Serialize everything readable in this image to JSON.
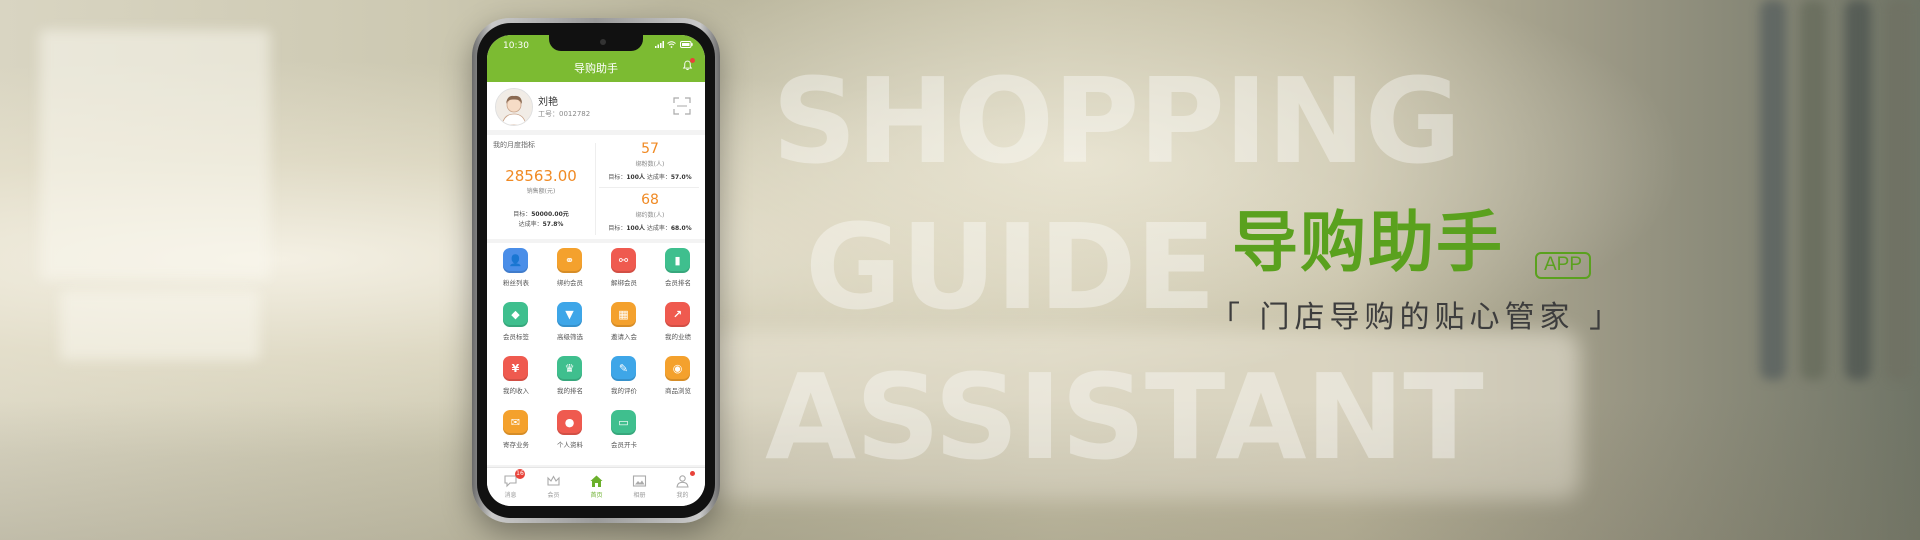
{
  "headline": {
    "en_lines": [
      "SHOPPING",
      "GUIDE",
      "ASSISTANT"
    ],
    "cn_title": "导购助手",
    "badge": "APP",
    "slogan": "「 门店导购的贴心管家 」"
  },
  "colors": {
    "brand_green": "#7cbb32",
    "title_green": "#5aa11e",
    "value_orange": "#f08a24"
  },
  "phone": {
    "status_time": "10:30",
    "nav_title": "导购助手",
    "profile": {
      "name": "刘艳",
      "employee_id": "工号：0012782"
    },
    "stats": {
      "title": "我的月度指标",
      "sales": {
        "value": "28563.00",
        "label": "销售额(元)",
        "target_label": "目标：",
        "target_value": "50000.00元",
        "rate_label": "达成率：",
        "rate_value": "57.8%"
      },
      "metrics": [
        {
          "value": "57",
          "label": "绑粉数(人)",
          "target_label": "目标：",
          "target_value": "100人",
          "rate_label": "达成率：",
          "rate_value": "57.0%"
        },
        {
          "value": "68",
          "label": "绑约数(人)",
          "target_label": "目标：",
          "target_value": "100人",
          "rate_label": "达成率：",
          "rate_value": "68.0%"
        }
      ]
    },
    "apps": [
      {
        "label": "粉丝列表",
        "icon": "fans-icon",
        "glyph": "👤",
        "color": "#4a8ee8"
      },
      {
        "label": "绑约会员",
        "icon": "link-icon",
        "glyph": "⚭",
        "color": "#f4a12d"
      },
      {
        "label": "解绑会员",
        "icon": "unlink-icon",
        "glyph": "⚯",
        "color": "#ef5a4f"
      },
      {
        "label": "会员排名",
        "icon": "ranking-chart-icon",
        "glyph": "▮",
        "color": "#3fbf8e"
      },
      {
        "label": "会员标签",
        "icon": "tag-icon",
        "glyph": "◆",
        "color": "#3fbf8e"
      },
      {
        "label": "高级筛选",
        "icon": "filter-icon",
        "glyph": "▼",
        "color": "#3ea6e8"
      },
      {
        "label": "邀请入会",
        "icon": "qr-code-icon",
        "glyph": "▦",
        "color": "#f4a12d"
      },
      {
        "label": "我的业绩",
        "icon": "trend-chart-icon",
        "glyph": "↗",
        "color": "#ef5a4f"
      },
      {
        "label": "我的收入",
        "icon": "yen-icon",
        "glyph": "¥",
        "color": "#ef5a4f"
      },
      {
        "label": "我的排名",
        "icon": "trophy-icon",
        "glyph": "♛",
        "color": "#3fbf8e"
      },
      {
        "label": "我的评价",
        "icon": "edit-icon",
        "glyph": "✎",
        "color": "#3ea6e8"
      },
      {
        "label": "商品浏览",
        "icon": "eye-icon",
        "glyph": "◉",
        "color": "#f4a12d"
      },
      {
        "label": "寄存业务",
        "icon": "bag-icon",
        "glyph": "✉",
        "color": "#f4a12d"
      },
      {
        "label": "个人资料",
        "icon": "person-icon",
        "glyph": "●",
        "color": "#ef5a4f"
      },
      {
        "label": "会员开卡",
        "icon": "card-icon",
        "glyph": "▭",
        "color": "#3fbf8e"
      }
    ],
    "tabs": [
      {
        "label": "消息",
        "icon": "message-icon",
        "badge": "16"
      },
      {
        "label": "会员",
        "icon": "crown-icon"
      },
      {
        "label": "首页",
        "icon": "home-icon",
        "active": true
      },
      {
        "label": "相册",
        "icon": "album-icon"
      },
      {
        "label": "我的",
        "icon": "profile-icon",
        "dot": true
      }
    ]
  }
}
